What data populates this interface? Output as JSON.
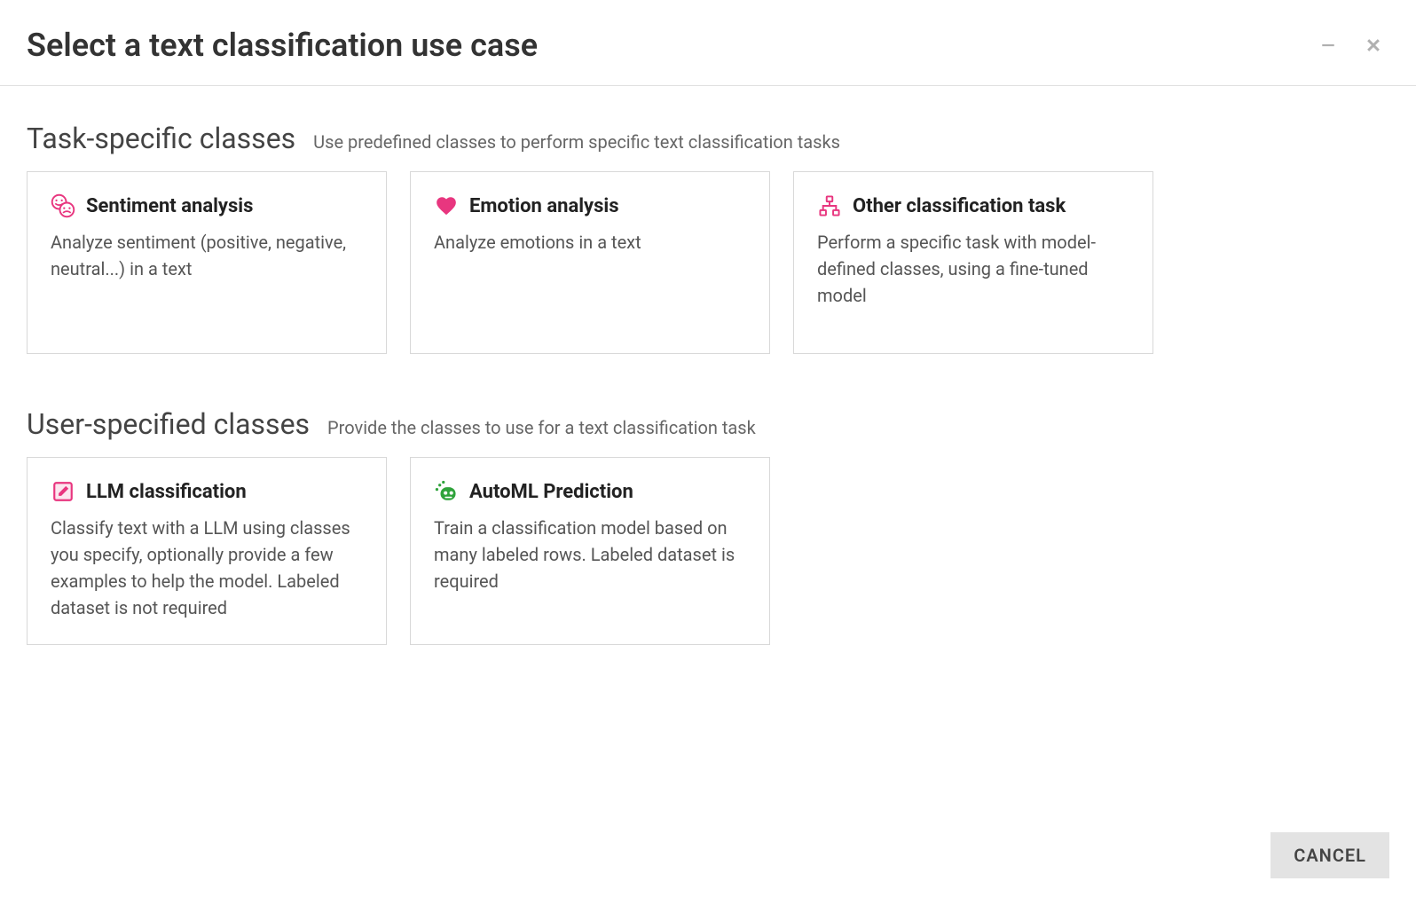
{
  "header": {
    "title": "Select a text classification use case"
  },
  "sections": {
    "task_specific": {
      "title": "Task-specific classes",
      "subtitle": "Use predefined classes to perform specific text classification tasks",
      "cards": {
        "sentiment": {
          "title": "Sentiment analysis",
          "desc": "Analyze sentiment (positive, negative, neutral...) in a text"
        },
        "emotion": {
          "title": "Emotion analysis",
          "desc": "Analyze emotions in a text"
        },
        "other": {
          "title": "Other classification task",
          "desc": "Perform a specific task with model-defined classes, using a fine-tuned model"
        }
      }
    },
    "user_specified": {
      "title": "User-specified classes",
      "subtitle": "Provide the classes to use for a text classification task",
      "cards": {
        "llm": {
          "title": "LLM classification",
          "desc": "Classify text with a LLM using classes you specify, optionally provide a few examples to help the model. Labeled dataset is not required"
        },
        "automl": {
          "title": "AutoML Prediction",
          "desc": "Train a classification model based on many labeled rows. Labeled dataset is required"
        }
      }
    }
  },
  "footer": {
    "cancel_label": "CANCEL"
  }
}
